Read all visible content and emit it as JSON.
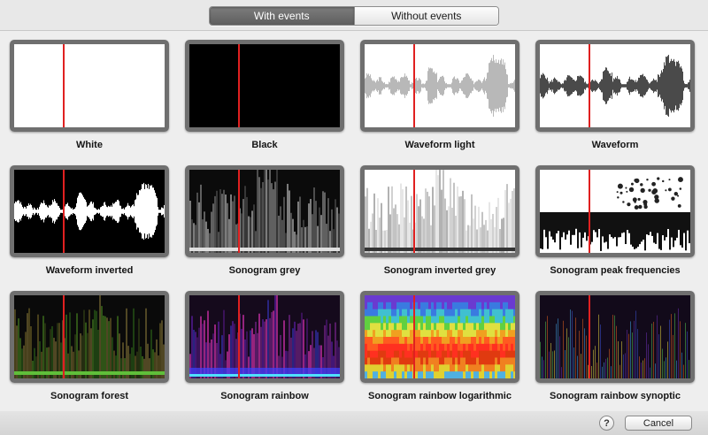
{
  "tabs": {
    "with_events": "With events",
    "without_events": "Without events"
  },
  "themes": [
    {
      "label": "White",
      "style": "white"
    },
    {
      "label": "Black",
      "style": "black"
    },
    {
      "label": "Waveform light",
      "style": "waveform-light"
    },
    {
      "label": "Waveform",
      "style": "waveform"
    },
    {
      "label": "Waveform inverted",
      "style": "waveform-inverted"
    },
    {
      "label": "Sonogram grey",
      "style": "sonogram-grey"
    },
    {
      "label": "Sonogram inverted grey",
      "style": "sonogram-inverted-grey"
    },
    {
      "label": "Sonogram peak frequencies",
      "style": "sonogram-peak"
    },
    {
      "label": "Sonogram forest",
      "style": "sonogram-forest"
    },
    {
      "label": "Sonogram rainbow",
      "style": "sonogram-rainbow"
    },
    {
      "label": "Sonogram rainbow logarithmic",
      "style": "sonogram-rainbow-log"
    },
    {
      "label": "Sonogram rainbow synoptic",
      "style": "sonogram-rainbow-synoptic"
    }
  ],
  "footer": {
    "help_label": "?",
    "cancel_label": "Cancel"
  },
  "colors": {
    "playhead": "#e02020",
    "tile_border": "#6f6f6f",
    "segment_active": "#6b6b6b"
  }
}
